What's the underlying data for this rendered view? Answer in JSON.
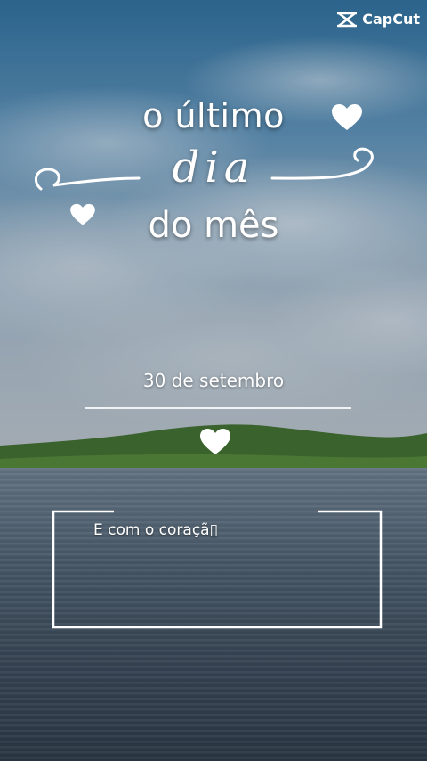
{
  "brand": {
    "name": "CapCut",
    "icon": "capcut-logo-icon"
  },
  "title": {
    "line1": "o último",
    "script_word": "dia",
    "line2": "do mês"
  },
  "date_text": "30 de setembro",
  "caption_text": "E com o coraçã▯",
  "decorations": {
    "heart_icon": "heart-icon",
    "colors": {
      "text": "#ffffff",
      "sky": "#2f6d9a",
      "water": "#4d5d6d",
      "hill": "#3f6b2e"
    }
  }
}
